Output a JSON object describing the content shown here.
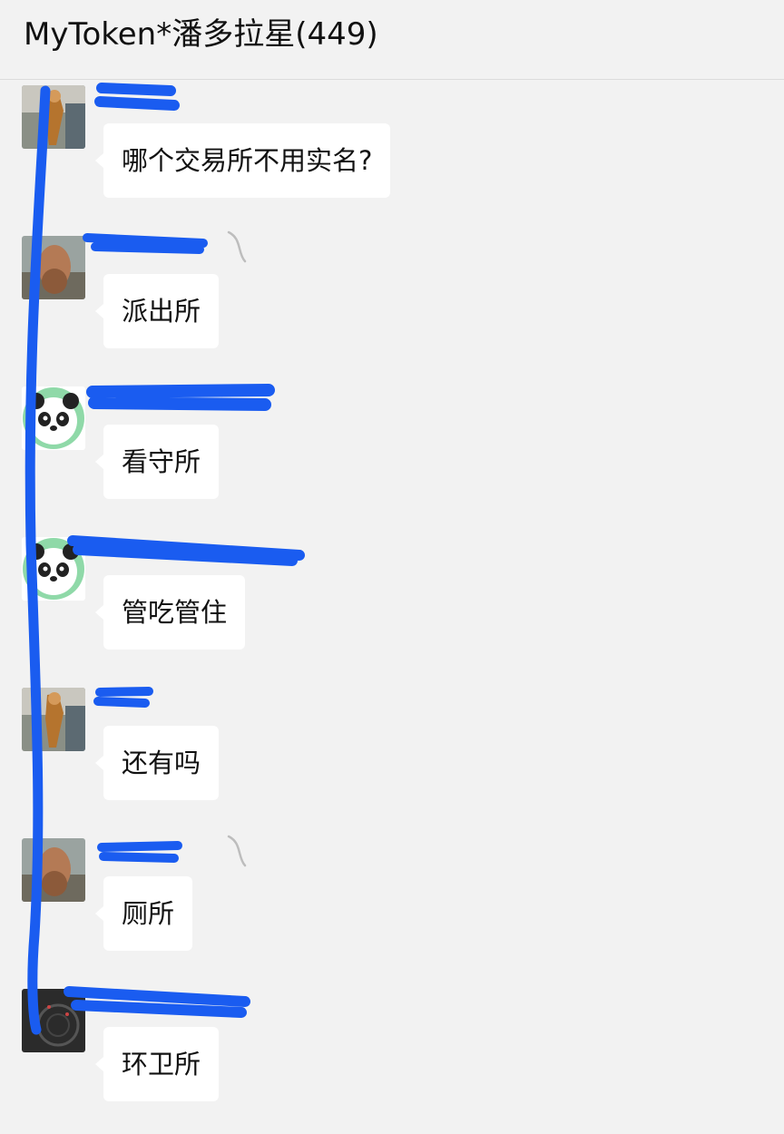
{
  "chat": {
    "title": "MyToken*潘多拉星(449)"
  },
  "messages": [
    {
      "text": "哪个交易所不用实名?",
      "avatar": "photo-avatar-1"
    },
    {
      "text": "派出所",
      "avatar": "photo-avatar-2"
    },
    {
      "text": "看守所",
      "avatar": "panda-avatar"
    },
    {
      "text": "管吃管住",
      "avatar": "panda-avatar"
    },
    {
      "text": "还有吗",
      "avatar": "photo-avatar-1"
    },
    {
      "text": "厕所",
      "avatar": "photo-avatar-2"
    },
    {
      "text": "环卫所",
      "avatar": "photo-avatar-3"
    }
  ],
  "colors": {
    "background": "#f2f2f2",
    "bubble": "#ffffff",
    "redaction_marker": "#1a5cf0"
  }
}
